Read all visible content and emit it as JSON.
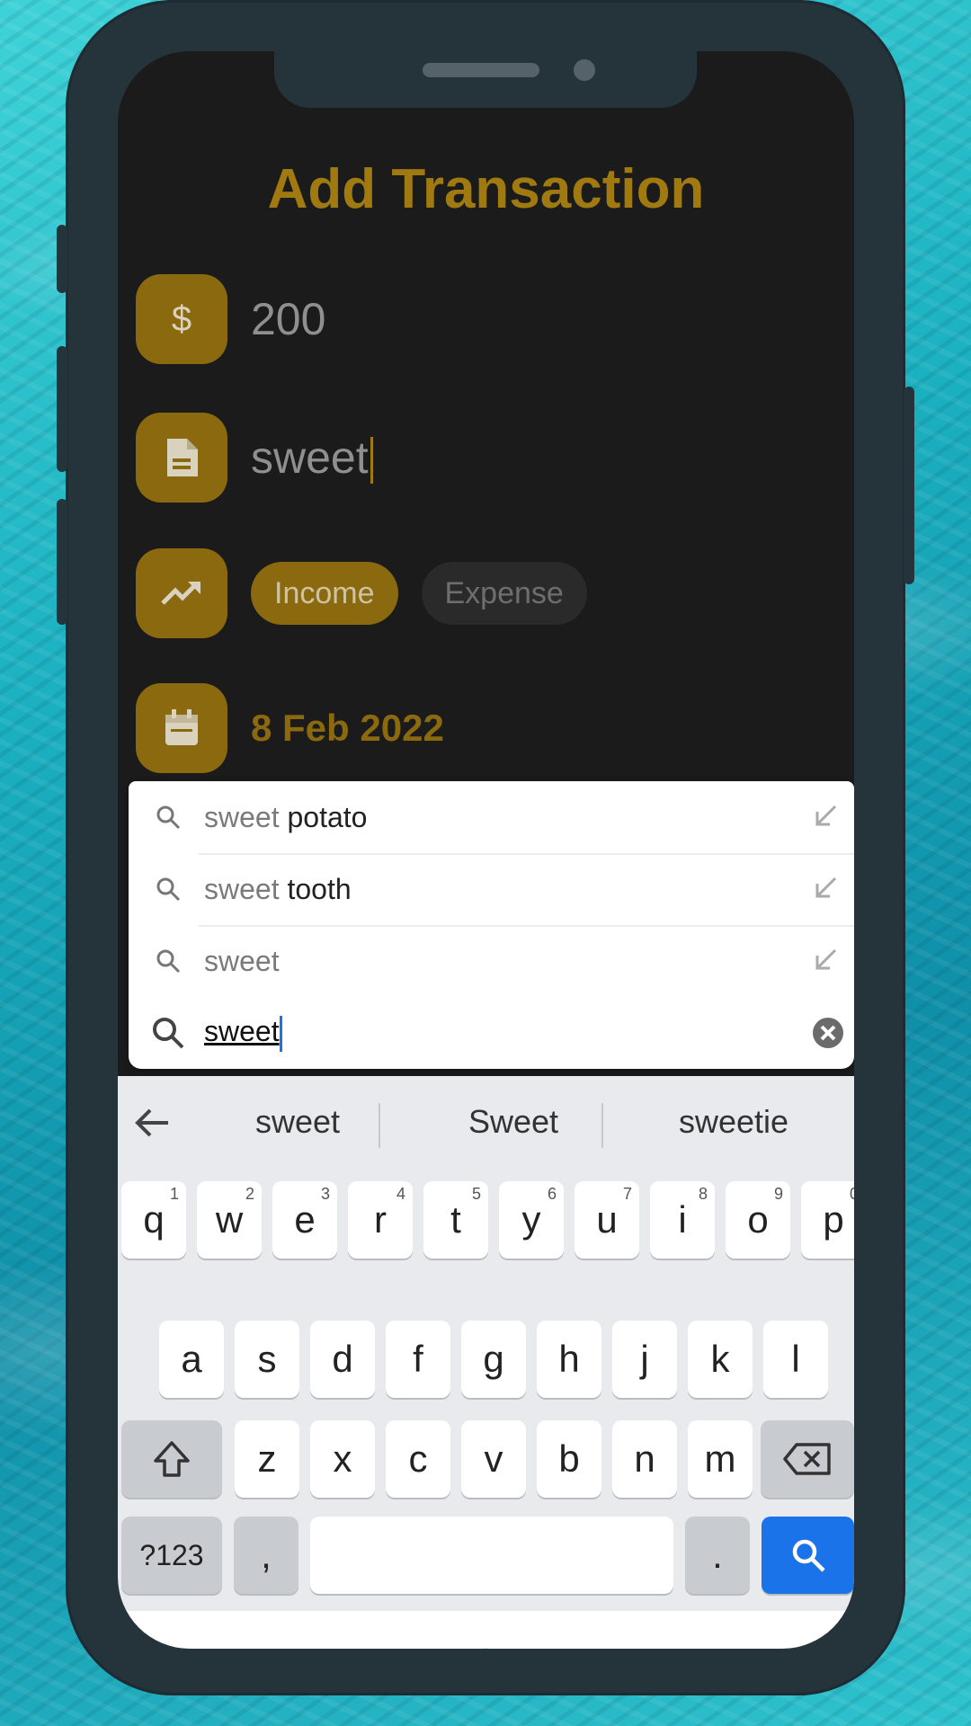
{
  "screen": {
    "title": "Add Transaction",
    "amount": {
      "value": "200",
      "icon": "dollar-icon"
    },
    "description": {
      "value": "sweet",
      "icon": "document-icon"
    },
    "type": {
      "icon": "trending-up-icon",
      "options": [
        "Income",
        "Expense"
      ],
      "selected": "Income"
    },
    "date": {
      "value": "8 Feb 2022",
      "icon": "calendar-icon"
    }
  },
  "suggestions": {
    "items": [
      {
        "prefix": "sweet",
        "suffix": " potato"
      },
      {
        "prefix": "sweet",
        "suffix": " tooth"
      },
      {
        "prefix": "sweet",
        "suffix": ""
      }
    ],
    "query": "sweet"
  },
  "keyboard": {
    "suggestions": [
      "sweet",
      "Sweet",
      "sweetie"
    ],
    "row1": [
      {
        "k": "q",
        "h": "1"
      },
      {
        "k": "w",
        "h": "2"
      },
      {
        "k": "e",
        "h": "3"
      },
      {
        "k": "r",
        "h": "4"
      },
      {
        "k": "t",
        "h": "5"
      },
      {
        "k": "y",
        "h": "6"
      },
      {
        "k": "u",
        "h": "7"
      },
      {
        "k": "i",
        "h": "8"
      },
      {
        "k": "o",
        "h": "9"
      },
      {
        "k": "p",
        "h": "0"
      }
    ],
    "row2": [
      "a",
      "s",
      "d",
      "f",
      "g",
      "h",
      "j",
      "k",
      "l"
    ],
    "row3": [
      "z",
      "x",
      "c",
      "v",
      "b",
      "n",
      "m"
    ],
    "symbols_label": "?123",
    "comma_label": ",",
    "period_label": "."
  },
  "colors": {
    "accent": "#8a690f",
    "title": "#a07a10",
    "background": "#1b1b1b",
    "search_key": "#1a73e8"
  }
}
